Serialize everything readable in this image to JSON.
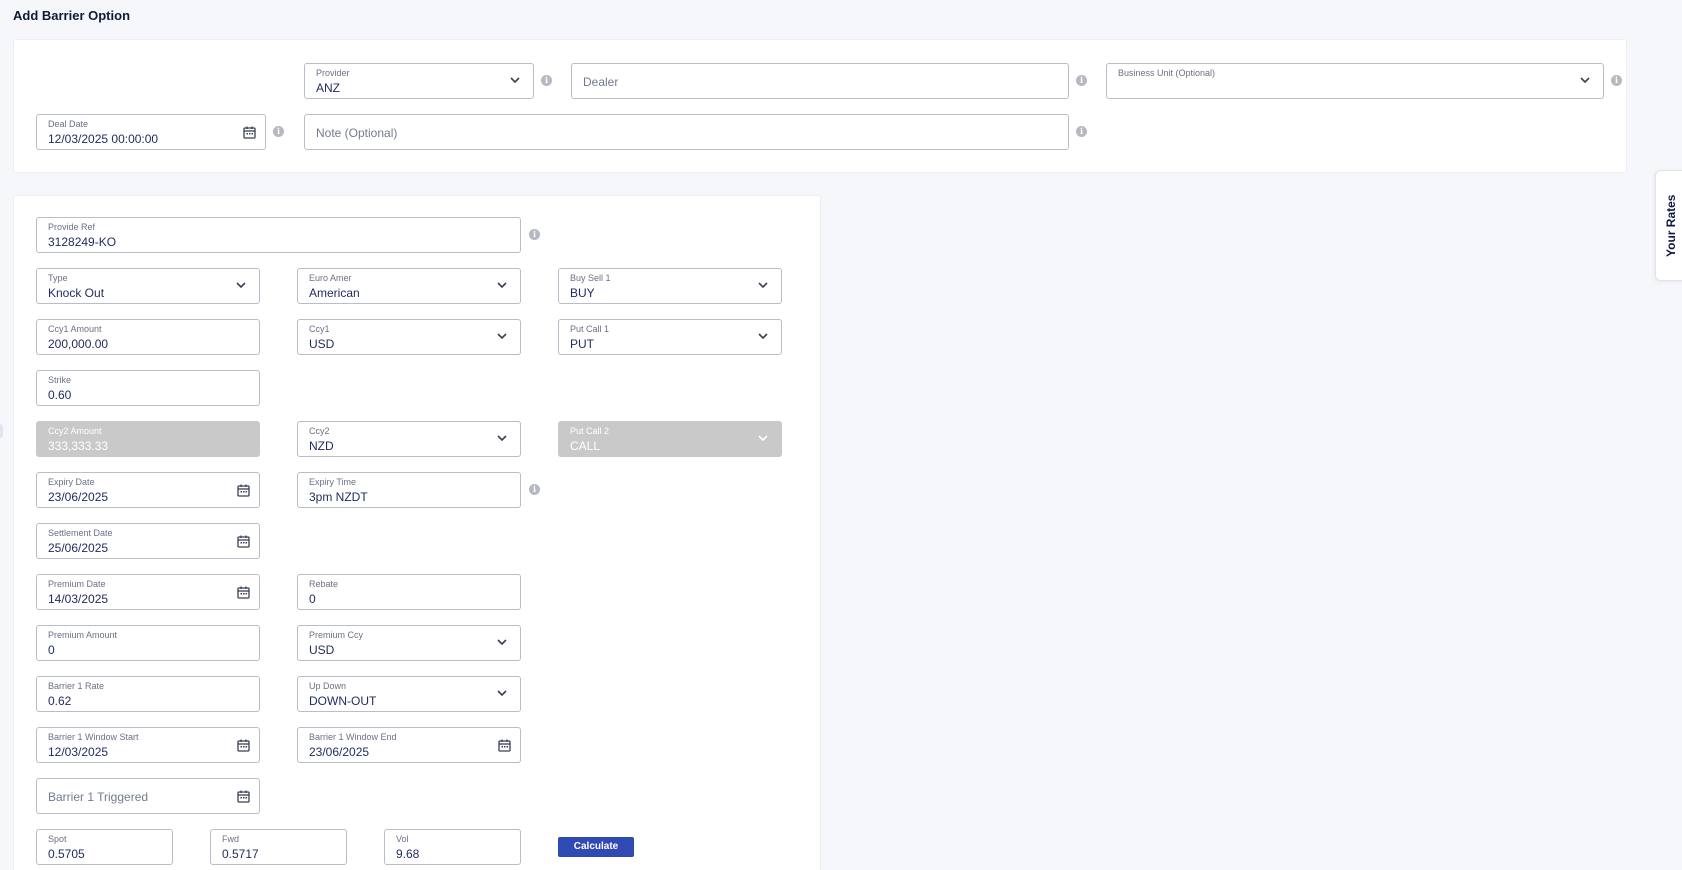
{
  "page": {
    "title": "Add Barrier Option"
  },
  "header": {
    "provider": {
      "label": "Provider",
      "value": "ANZ"
    },
    "dealer": {
      "placeholder": "Dealer"
    },
    "business_unit": {
      "label": "Business Unit (Optional)",
      "value": ""
    },
    "deal_date": {
      "label": "Deal Date",
      "value": "12/03/2025 00:00:00"
    },
    "note": {
      "placeholder": "Note (Optional)"
    }
  },
  "form": {
    "provide_ref": {
      "label": "Provide Ref",
      "value": "3128249-KO"
    },
    "type": {
      "label": "Type",
      "value": "Knock Out"
    },
    "euro_amer": {
      "label": "Euro Amer",
      "value": "American"
    },
    "buy_sell_1": {
      "label": "Buy Sell 1",
      "value": "BUY"
    },
    "ccy1_amount": {
      "label": "Ccy1 Amount",
      "value": "200,000.00"
    },
    "ccy1": {
      "label": "Ccy1",
      "value": "USD"
    },
    "put_call_1": {
      "label": "Put Call 1",
      "value": "PUT"
    },
    "strike": {
      "label": "Strike",
      "value": "0.60"
    },
    "ccy2_amount": {
      "label": "Ccy2 Amount",
      "value": "333,333.33"
    },
    "ccy2": {
      "label": "Ccy2",
      "value": "NZD"
    },
    "put_call_2": {
      "label": "Put Call 2",
      "value": "CALL"
    },
    "expiry_date": {
      "label": "Expiry Date",
      "value": "23/06/2025"
    },
    "expiry_time": {
      "label": "Expiry Time",
      "value": "3pm NZDT"
    },
    "settlement_date": {
      "label": "Settlement Date",
      "value": "25/06/2025"
    },
    "premium_date": {
      "label": "Premium Date",
      "value": "14/03/2025"
    },
    "rebate": {
      "label": "Rebate",
      "value": "0"
    },
    "premium_amount": {
      "label": "Premium Amount",
      "value": "0"
    },
    "premium_ccy": {
      "label": "Premium Ccy",
      "value": "USD"
    },
    "barrier_1_rate": {
      "label": "Barrier 1 Rate",
      "value": "0.62"
    },
    "up_down": {
      "label": "Up Down",
      "value": "DOWN-OUT"
    },
    "barrier_1_window_start": {
      "label": "Barrier 1 Window Start",
      "value": "12/03/2025"
    },
    "barrier_1_window_end": {
      "label": "Barrier 1 Window End",
      "value": "23/06/2025"
    },
    "barrier_1_triggered": {
      "placeholder": "Barrier 1 Triggered"
    },
    "spot": {
      "label": "Spot",
      "value": "0.5705"
    },
    "fwd": {
      "label": "Fwd",
      "value": "0.5717"
    },
    "vol": {
      "label": "Vol",
      "value": "9.68"
    },
    "calculate_label": "Calculate"
  },
  "side_tab": {
    "label": "Your Rates"
  },
  "icons": {
    "info": "info-icon",
    "dropdown": "chevron-down-icon",
    "date": "calendar-icon"
  },
  "colors": {
    "accent": "#2f4ab3",
    "disabled": "#c9c9c9",
    "text": "#1f2a5c"
  }
}
